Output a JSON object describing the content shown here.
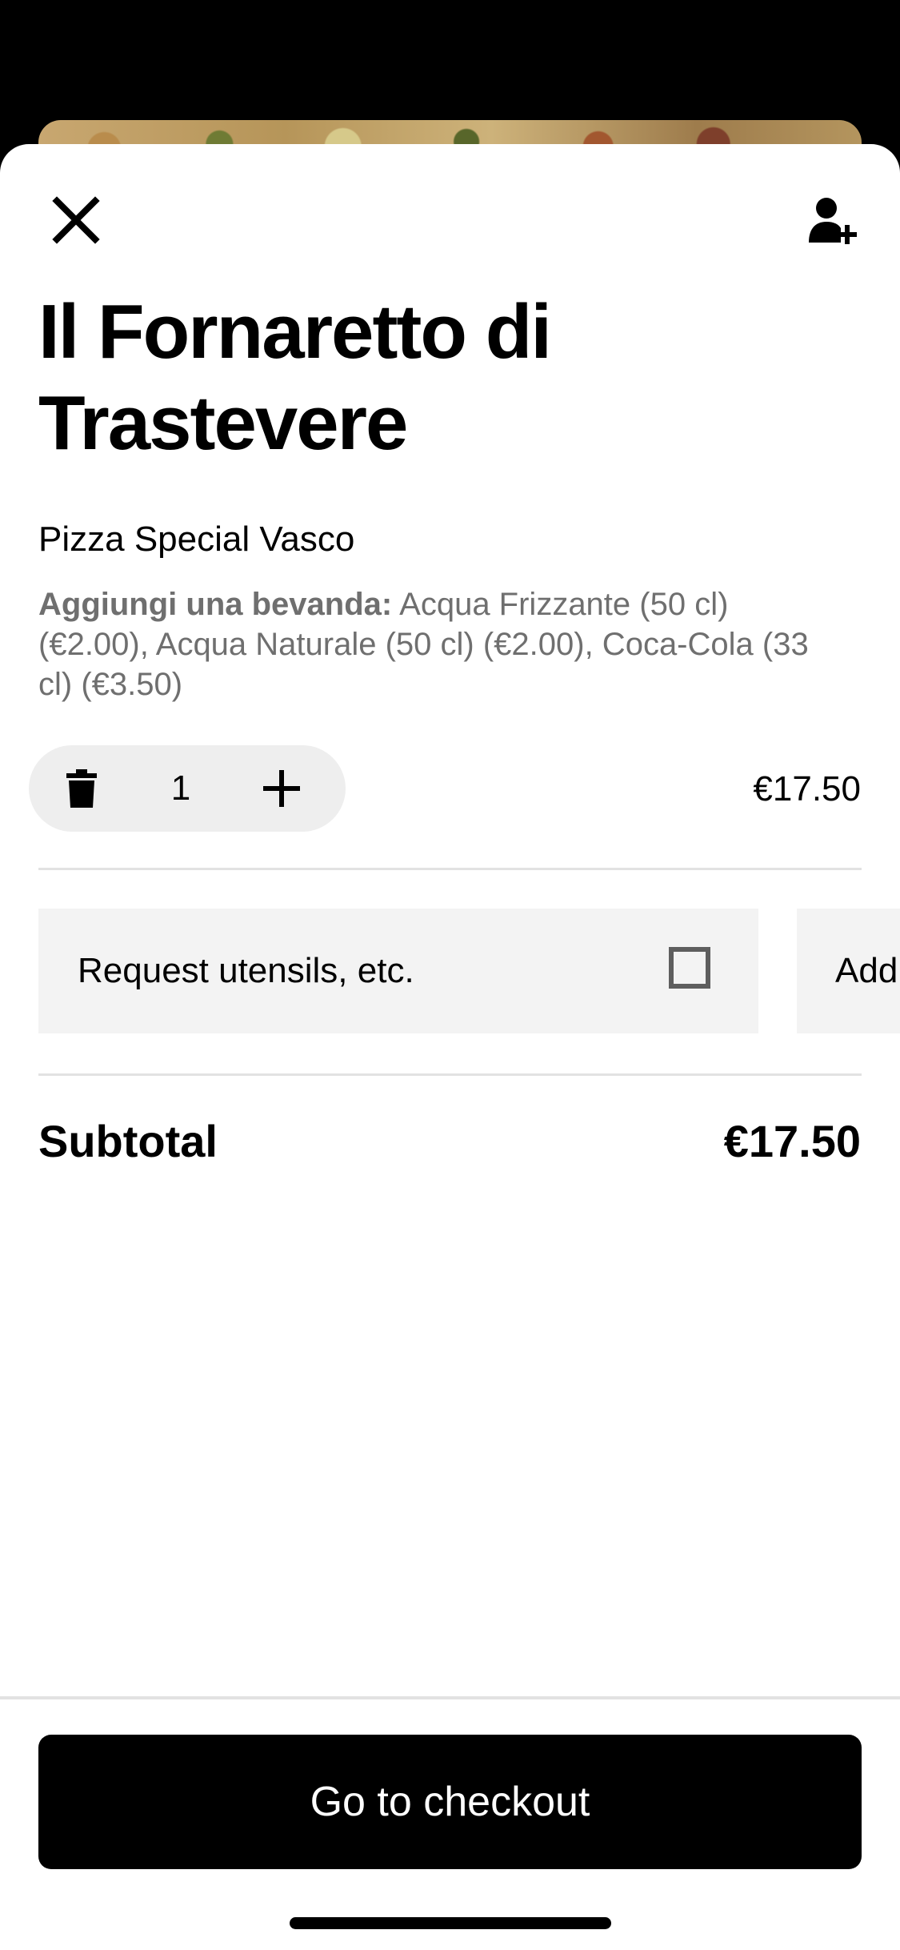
{
  "store": {
    "title": "Il Fornaretto di Trastevere"
  },
  "item": {
    "name": "Pizza Special Vasco",
    "options_label": "Aggiungi una bevanda:",
    "options_value": " Acqua Frizzante (50 cl) (€2.00), Acqua Naturale (50 cl) (€2.00), Coca-Cola (33 cl) (€3.50)",
    "quantity": "1",
    "price": "€17.50"
  },
  "extras": {
    "utensils_label": "Request utensils, etc.",
    "utensils_checked": false,
    "note_label": "Add"
  },
  "summary": {
    "subtotal_label": "Subtotal",
    "subtotal_value": "€17.50"
  },
  "checkout": {
    "button_label": "Go to checkout"
  },
  "icons": {
    "close": "close-icon",
    "add_person": "add-person-icon",
    "trash": "trash-icon",
    "plus": "plus-icon"
  },
  "colors": {
    "primary": "#000000",
    "background": "#ffffff",
    "chip_background": "#f3f3f3",
    "stepper_background": "#eeeeee",
    "secondary_text": "#6f6f6f"
  }
}
